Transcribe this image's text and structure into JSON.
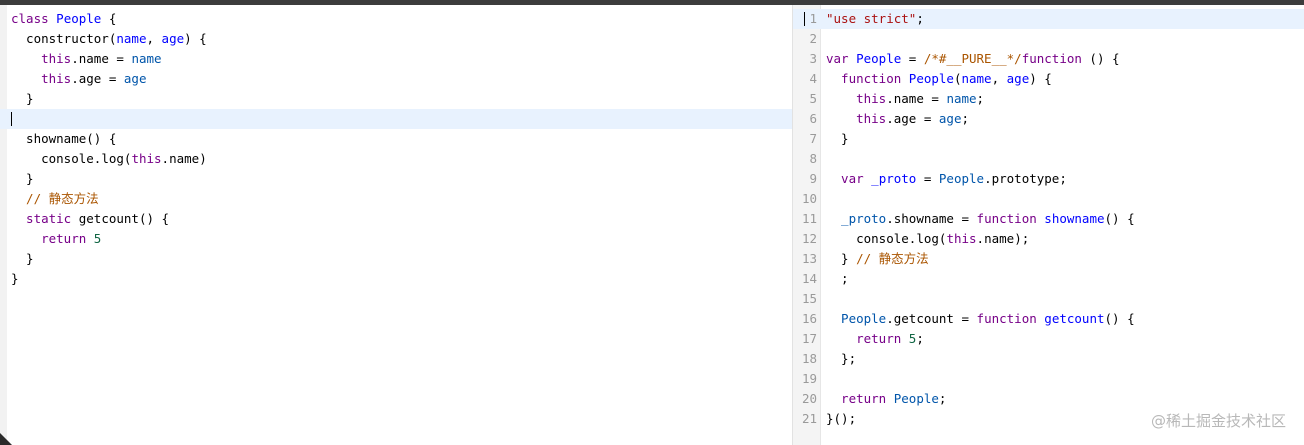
{
  "left_editor": {
    "lines": [
      [
        [
          "kw",
          "class"
        ],
        [
          "def",
          " People"
        ],
        [
          "punc",
          " {"
        ]
      ],
      [
        [
          "prop",
          "  constructor"
        ],
        [
          "punc",
          "("
        ],
        [
          "def",
          "name"
        ],
        [
          "punc",
          ", "
        ],
        [
          "def",
          "age"
        ],
        [
          "punc",
          ") {"
        ]
      ],
      [
        [
          "this",
          "    this"
        ],
        [
          "punc",
          "."
        ],
        [
          "prop",
          "name"
        ],
        [
          "op",
          " = "
        ],
        [
          "var2",
          "name"
        ]
      ],
      [
        [
          "this",
          "    this"
        ],
        [
          "punc",
          "."
        ],
        [
          "prop",
          "age"
        ],
        [
          "op",
          " = "
        ],
        [
          "var2",
          "age"
        ]
      ],
      [
        [
          "punc",
          "  }"
        ]
      ],
      [],
      [
        [
          "prop",
          "  showname"
        ],
        [
          "punc",
          "() {"
        ]
      ],
      [
        [
          "var",
          "    console"
        ],
        [
          "punc",
          "."
        ],
        [
          "prop",
          "log"
        ],
        [
          "punc",
          "("
        ],
        [
          "this",
          "this"
        ],
        [
          "punc",
          "."
        ],
        [
          "prop",
          "name"
        ],
        [
          "punc",
          ")"
        ]
      ],
      [
        [
          "punc",
          "  }"
        ]
      ],
      [
        [
          "cmt",
          "  // 静态方法"
        ]
      ],
      [
        [
          "kw",
          "  static"
        ],
        [
          "prop",
          " getcount"
        ],
        [
          "punc",
          "() {"
        ]
      ],
      [
        [
          "kw",
          "    return"
        ],
        [
          "num",
          " 5"
        ]
      ],
      [
        [
          "punc",
          "  }"
        ]
      ],
      [
        [
          "punc",
          "}"
        ]
      ]
    ]
  },
  "right_editor": {
    "line_numbers": [
      "1",
      "2",
      "3",
      "4",
      "5",
      "6",
      "7",
      "8",
      "9",
      "10",
      "11",
      "12",
      "13",
      "14",
      "15",
      "16",
      "17",
      "18",
      "19",
      "20",
      "21"
    ],
    "lines": [
      [
        [
          "str",
          "\"use strict\""
        ],
        [
          "punc",
          ";"
        ]
      ],
      [],
      [
        [
          "kw",
          "var"
        ],
        [
          "def",
          " People"
        ],
        [
          "op",
          " = "
        ],
        [
          "cmt",
          "/*#__PURE__*/"
        ],
        [
          "kw",
          "function"
        ],
        [
          "punc",
          " () {"
        ]
      ],
      [
        [
          "kw",
          "  function"
        ],
        [
          "def",
          " People"
        ],
        [
          "punc",
          "("
        ],
        [
          "def",
          "name"
        ],
        [
          "punc",
          ", "
        ],
        [
          "def",
          "age"
        ],
        [
          "punc",
          ") {"
        ]
      ],
      [
        [
          "this",
          "    this"
        ],
        [
          "punc",
          "."
        ],
        [
          "prop",
          "name"
        ],
        [
          "op",
          " = "
        ],
        [
          "var2",
          "name"
        ],
        [
          "punc",
          ";"
        ]
      ],
      [
        [
          "this",
          "    this"
        ],
        [
          "punc",
          "."
        ],
        [
          "prop",
          "age"
        ],
        [
          "op",
          " = "
        ],
        [
          "var2",
          "age"
        ],
        [
          "punc",
          ";"
        ]
      ],
      [
        [
          "punc",
          "  }"
        ]
      ],
      [],
      [
        [
          "kw",
          "  var"
        ],
        [
          "def",
          " _proto"
        ],
        [
          "op",
          " = "
        ],
        [
          "var2",
          "People"
        ],
        [
          "punc",
          "."
        ],
        [
          "prop",
          "prototype"
        ],
        [
          "punc",
          ";"
        ]
      ],
      [],
      [
        [
          "var2",
          "  _proto"
        ],
        [
          "punc",
          "."
        ],
        [
          "prop",
          "showname"
        ],
        [
          "op",
          " = "
        ],
        [
          "kw",
          "function"
        ],
        [
          "def",
          " showname"
        ],
        [
          "punc",
          "() {"
        ]
      ],
      [
        [
          "var",
          "    console"
        ],
        [
          "punc",
          "."
        ],
        [
          "prop",
          "log"
        ],
        [
          "punc",
          "("
        ],
        [
          "this",
          "this"
        ],
        [
          "punc",
          "."
        ],
        [
          "prop",
          "name"
        ],
        [
          "punc",
          ");"
        ]
      ],
      [
        [
          "punc",
          "  }"
        ],
        [
          "cmt",
          " // 静态方法"
        ]
      ],
      [
        [
          "punc",
          "  ;"
        ]
      ],
      [],
      [
        [
          "var2",
          "  People"
        ],
        [
          "punc",
          "."
        ],
        [
          "prop",
          "getcount"
        ],
        [
          "op",
          " = "
        ],
        [
          "kw",
          "function"
        ],
        [
          "def",
          " getcount"
        ],
        [
          "punc",
          "() {"
        ]
      ],
      [
        [
          "kw",
          "    return"
        ],
        [
          "num",
          " 5"
        ],
        [
          "punc",
          ";"
        ]
      ],
      [
        [
          "punc",
          "  };"
        ]
      ],
      [],
      [
        [
          "kw",
          "  return"
        ],
        [
          "var2",
          " People"
        ],
        [
          "punc",
          ";"
        ]
      ],
      [
        [
          "punc",
          "}();"
        ]
      ]
    ]
  },
  "watermark": "@稀土掘金技术社区"
}
